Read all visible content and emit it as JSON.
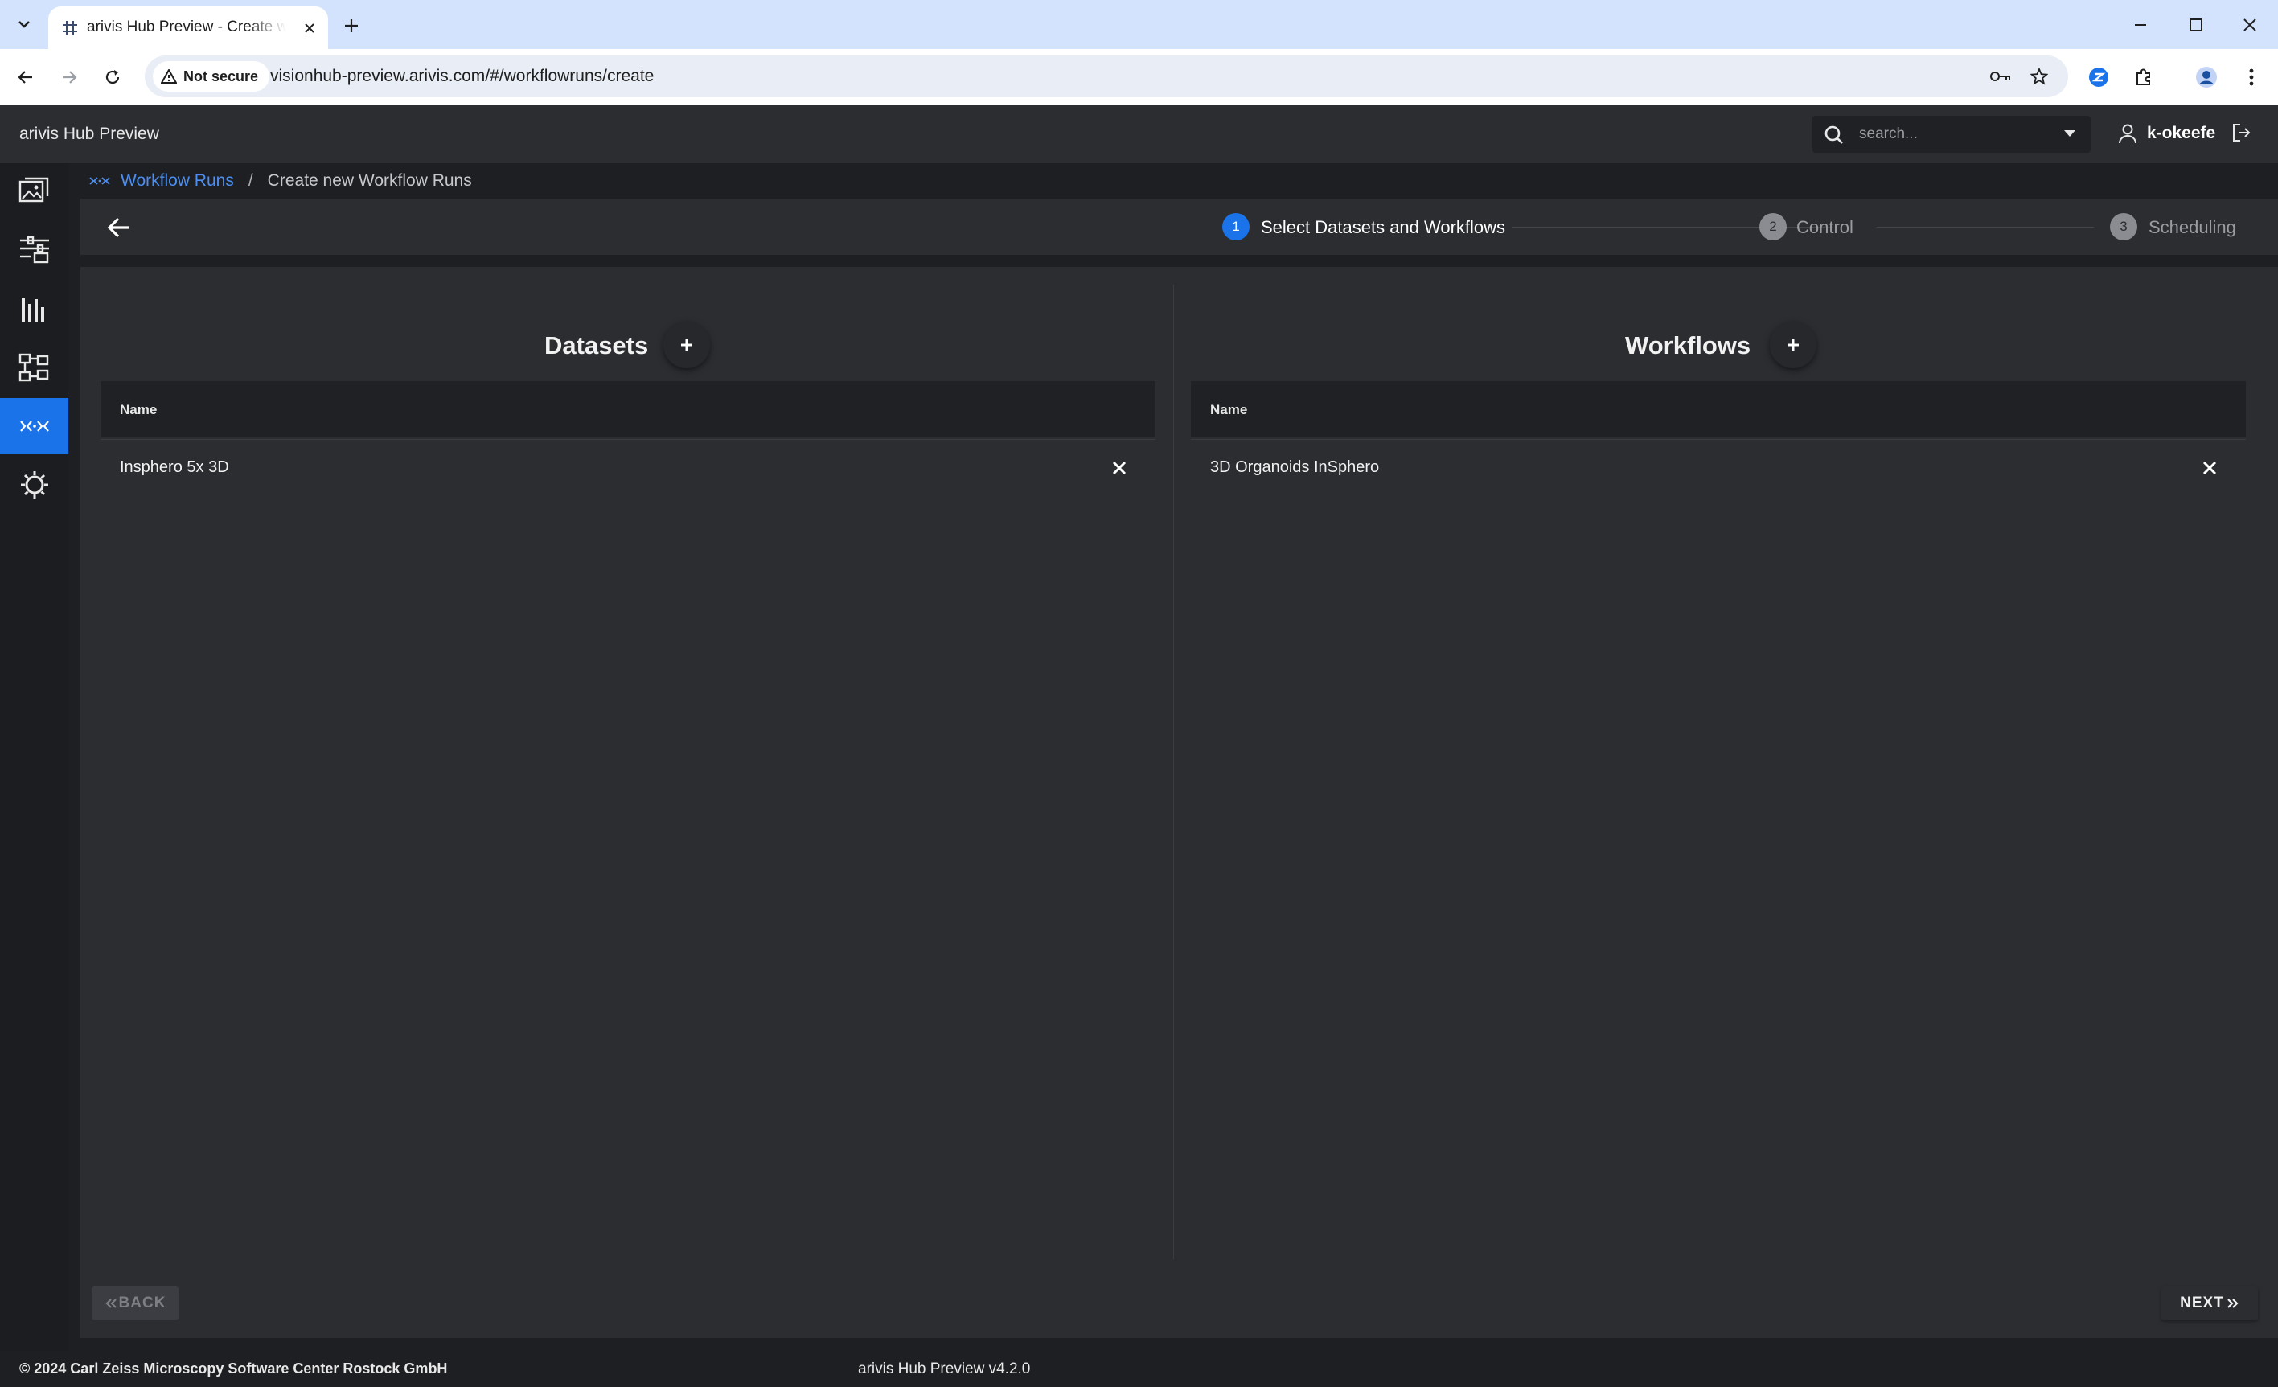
{
  "browser": {
    "tab_title": "arivis Hub Preview - Create workflow runs",
    "security_label": "Not secure",
    "url": "visionhub-preview.arivis.com/#/workflowruns/create"
  },
  "app": {
    "title": "arivis Hub Preview",
    "search_placeholder": "search...",
    "user_name": "k-okeefe"
  },
  "sidebar": {
    "items": [
      {
        "icon": "images-icon"
      },
      {
        "icon": "sliders-icon"
      },
      {
        "icon": "bar-chart-icon"
      },
      {
        "icon": "hierarchy-icon"
      },
      {
        "icon": "workflow-runs-icon",
        "active": true
      },
      {
        "icon": "settings-icon"
      }
    ]
  },
  "breadcrumb": {
    "link": "Workflow Runs",
    "separator": "/",
    "current": "Create new Workflow Runs"
  },
  "stepper": {
    "steps": [
      {
        "number": "1",
        "label": "Select Datasets and Workflows",
        "active": true
      },
      {
        "number": "2",
        "label": "Control",
        "active": false
      },
      {
        "number": "3",
        "label": "Scheduling",
        "active": false
      }
    ]
  },
  "datasets": {
    "title": "Datasets",
    "column": "Name",
    "rows": [
      "Insphero 5x 3D"
    ]
  },
  "workflows": {
    "title": "Workflows",
    "column": "Name",
    "rows": [
      "3D Organoids InSphero"
    ]
  },
  "actions": {
    "back_label": "BACK",
    "next_label": "NEXT"
  },
  "footer": {
    "copyright": "© 2024 Carl Zeiss Microscopy Software Center Rostock GmbH",
    "version": "arivis Hub Preview v4.2.0"
  },
  "colors": {
    "accent": "#1a73e8",
    "link": "#4d8ff0",
    "surface": "#2b2d31",
    "background": "#1e1f22"
  }
}
